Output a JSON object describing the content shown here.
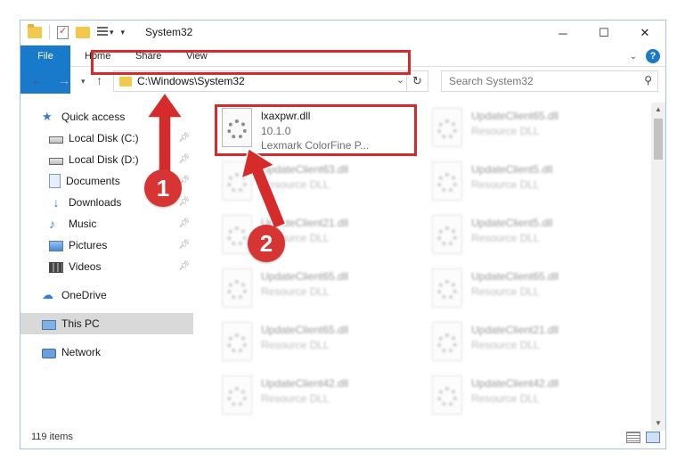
{
  "window": {
    "title": "System32",
    "controls": {
      "minimize": "─",
      "maximize": "☐",
      "close": "✕"
    }
  },
  "ribbon": {
    "tabs": [
      "File",
      "Home",
      "Share",
      "View"
    ],
    "help": "?"
  },
  "navigation": {
    "address": "C:\\Windows\\System32",
    "search_placeholder": "Search System32"
  },
  "sidebar": {
    "items": [
      {
        "label": "Quick access",
        "icon": "star-icon",
        "pinned": false,
        "selected": false
      },
      {
        "label": "Local Disk (C:)",
        "icon": "drive-icon",
        "pinned": true,
        "selected": false
      },
      {
        "label": "Local Disk (D:)",
        "icon": "drive-icon",
        "pinned": true,
        "selected": false
      },
      {
        "label": "Documents",
        "icon": "documents-icon",
        "pinned": true,
        "selected": false
      },
      {
        "label": "Downloads",
        "icon": "downloads-icon",
        "pinned": true,
        "selected": false
      },
      {
        "label": "Music",
        "icon": "music-icon",
        "pinned": true,
        "selected": false
      },
      {
        "label": "Pictures",
        "icon": "pictures-icon",
        "pinned": true,
        "selected": false
      },
      {
        "label": "Videos",
        "icon": "videos-icon",
        "pinned": true,
        "selected": false
      },
      {
        "label": "OneDrive",
        "icon": "onedrive-icon",
        "pinned": false,
        "selected": false
      },
      {
        "label": "This PC",
        "icon": "this-pc-icon",
        "pinned": false,
        "selected": true
      },
      {
        "label": "Network",
        "icon": "network-icon",
        "pinned": false,
        "selected": false
      }
    ]
  },
  "files": {
    "highlighted": {
      "name": "lxaxpwr.dll",
      "version": "10.1.0",
      "description": "Lexmark ColorFine P..."
    },
    "blurred": [
      {
        "name": "UpdateClient65.dll",
        "type": "Resource DLL"
      },
      {
        "name": "UpdateClient63.dll",
        "type": "Resource DLL"
      },
      {
        "name": "UpdateClient5.dll",
        "type": "Resource DLL"
      },
      {
        "name": "UpdateClient21.dll",
        "type": "Resource DLL"
      },
      {
        "name": "UpdateClient5.dll",
        "type": "Resource DLL"
      },
      {
        "name": "UpdateClient65.dll",
        "type": "Resource DLL"
      },
      {
        "name": "UpdateClient65.dll",
        "type": "Resource DLL"
      },
      {
        "name": "UpdateClient65.dll",
        "type": "Resource DLL"
      },
      {
        "name": "UpdateClient21.dll",
        "type": "Resource DLL"
      },
      {
        "name": "UpdateClient42.dll",
        "type": "Resource DLL"
      },
      {
        "name": "UpdateClient42.dll",
        "type": "Resource DLL"
      }
    ]
  },
  "status": {
    "item_count": "119 items"
  },
  "annotations": {
    "badge1": "1",
    "badge2": "2",
    "color": "#d62b2b"
  },
  "colors": {
    "file_tab": "#1979ca",
    "accent": "#1979ca",
    "selection": "#d9d9d9"
  }
}
